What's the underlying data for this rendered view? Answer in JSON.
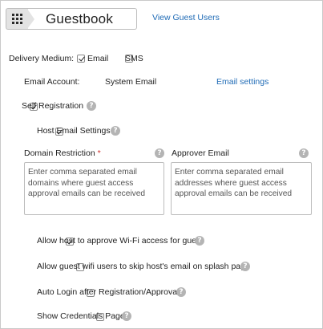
{
  "header": {
    "icon": "grid-icon",
    "title": "Guestbook",
    "view_users_link": "View Guest Users"
  },
  "delivery": {
    "label": "Delivery Medium:",
    "email_label": "Email",
    "email_checked": true,
    "sms_label": "SMS",
    "sms_checked": false
  },
  "email_account": {
    "label": "Email Account:",
    "value": "System Email",
    "settings_link": "Email settings"
  },
  "self_registration": {
    "label": "Self Registration",
    "checked": true
  },
  "host_email_settings": {
    "label": "Host Email Settings",
    "checked": true
  },
  "domain_restriction": {
    "label": "Domain Restriction",
    "required_mark": "*",
    "placeholder": "Enter comma separated email domains where guest access approval emails can be received"
  },
  "approver_email": {
    "label": "Approver Email",
    "placeholder": "Enter comma separated email addresses where guest access approval emails can be received"
  },
  "options": [
    {
      "label": "Allow host to approve Wi-Fi access for guest",
      "checked": true
    },
    {
      "label": "Allow guest wifi users to skip host's email on splash page",
      "checked": false
    },
    {
      "label": "Auto Login after Registration/Approval",
      "checked": false
    },
    {
      "label": "Show Credentials Page",
      "checked": false
    }
  ],
  "help_glyph": "?",
  "colors": {
    "link": "#1f6bb6",
    "required": "#d0312d",
    "help_badge": "#b4b4b4"
  }
}
